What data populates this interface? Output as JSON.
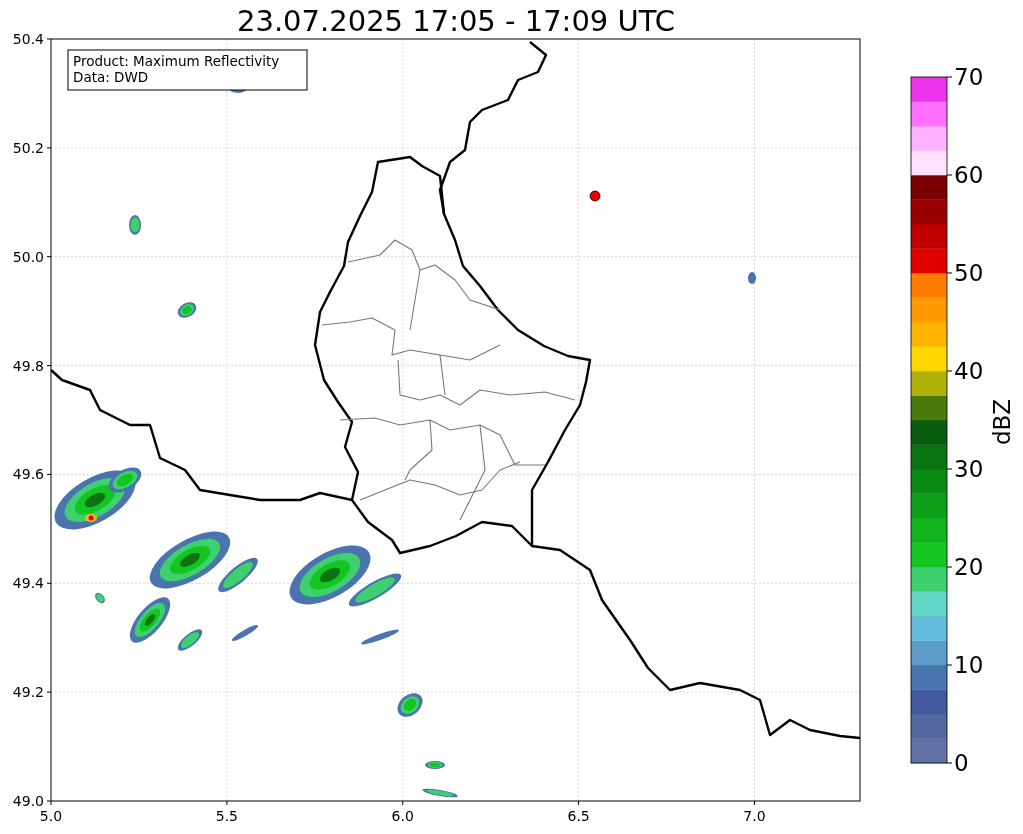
{
  "title": "23.07.2025 17:05 - 17:09 UTC",
  "info_box": [
    "Product: Maximum Reflectivity",
    "Data: DWD"
  ],
  "x_ticks": [
    "5.0",
    "5.5",
    "6.0",
    "6.5",
    "7.0"
  ],
  "y_ticks": [
    "50.4",
    "50.2",
    "50.0",
    "49.8",
    "49.6",
    "49.4",
    "49.2",
    "49.0"
  ],
  "colorbar": {
    "label": "dBZ",
    "ticks": [
      "70",
      "60",
      "50",
      "40",
      "30",
      "20",
      "10",
      "0"
    ],
    "segments": [
      {
        "color": "#6272a6"
      },
      {
        "color": "#55679f"
      },
      {
        "color": "#42589f"
      },
      {
        "color": "#4a74ae"
      },
      {
        "color": "#5b9cc8"
      },
      {
        "color": "#65bddd"
      },
      {
        "color": "#63d6c7"
      },
      {
        "color": "#3ecf6e"
      },
      {
        "color": "#12c520"
      },
      {
        "color": "#10b41c"
      },
      {
        "color": "#0ea01a"
      },
      {
        "color": "#0b8915"
      },
      {
        "color": "#0a7312"
      },
      {
        "color": "#095b0e"
      },
      {
        "color": "#4a7a0c"
      },
      {
        "color": "#b0b00b"
      },
      {
        "color": "#ffd700"
      },
      {
        "color": "#ffb400"
      },
      {
        "color": "#ff9a00"
      },
      {
        "color": "#ff7c00"
      },
      {
        "color": "#e00000"
      },
      {
        "color": "#c00000"
      },
      {
        "color": "#9a0000"
      },
      {
        "color": "#780000"
      },
      {
        "color": "#ffe0ff"
      },
      {
        "color": "#ffb3ff"
      },
      {
        "color": "#ff6eff"
      },
      {
        "color": "#ee33ee"
      }
    ]
  }
}
